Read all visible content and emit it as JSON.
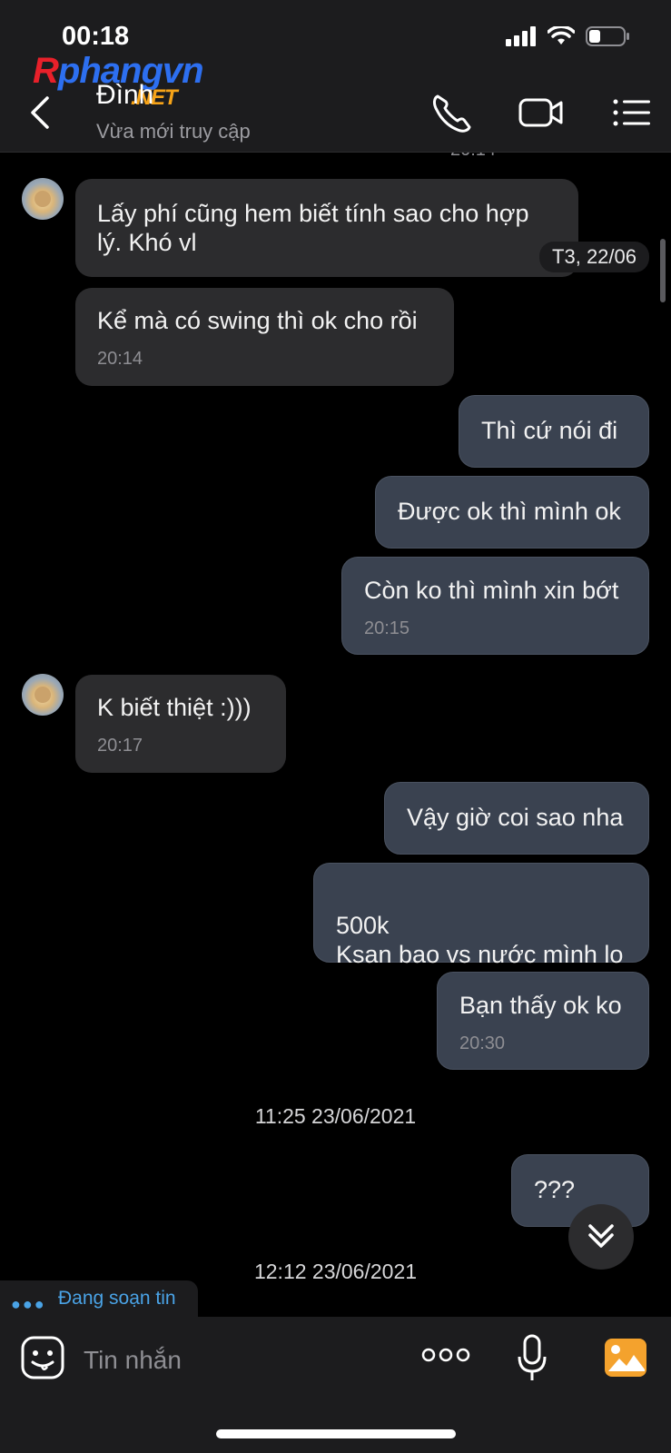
{
  "status_bar": {
    "time": "00:18"
  },
  "header": {
    "watermark": {
      "r": "R",
      "rest": "phangvn",
      "net": ".NET"
    },
    "contact_name": "Đình",
    "contact_status": "Vừa mới truy cập"
  },
  "chat": {
    "top_partial_time": "20:14",
    "date_chip": "T3, 22/06",
    "messages": [
      {
        "dir": "in",
        "text": "Lấy phí cũng hem biết tính sao cho hợp lý. Khó vl",
        "time": ""
      },
      {
        "dir": "in",
        "text": "Kể mà có swing thì ok cho rồi",
        "time": "20:14"
      },
      {
        "dir": "out",
        "text": "Thì cứ nói đi",
        "time": ""
      },
      {
        "dir": "out",
        "text": "Được ok thì mình ok",
        "time": ""
      },
      {
        "dir": "out",
        "text": "Còn ko thì mình xin bớt",
        "time": "20:15"
      },
      {
        "dir": "in",
        "text": "K biết thiệt :)))",
        "time": "20:17"
      },
      {
        "dir": "out",
        "text": "Vậy giờ coi sao nha",
        "time": ""
      },
      {
        "dir": "out",
        "text": "500k\nKsan bao vs nước mình lo",
        "time": ""
      },
      {
        "dir": "out",
        "text": "Bạn thấy ok ko",
        "time": "20:30"
      },
      {
        "dir": "out",
        "text": "???",
        "time": ""
      }
    ],
    "date_separators": [
      "11:25 23/06/2021",
      "12:12 23/06/2021"
    ],
    "typing_indicator": "Đang soạn tin"
  },
  "composer": {
    "placeholder": "Tin nhắn"
  }
}
